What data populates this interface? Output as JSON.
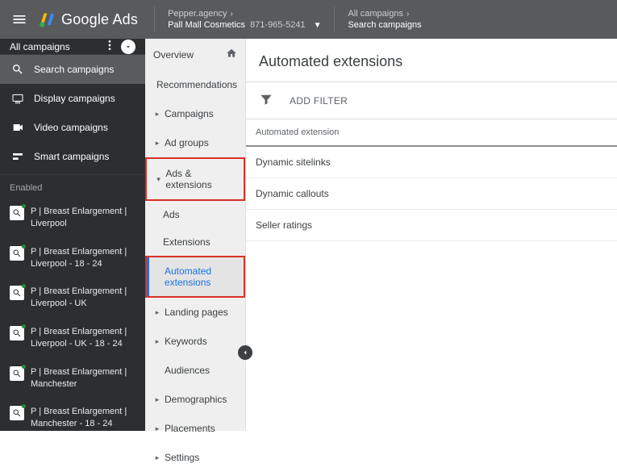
{
  "topbar": {
    "product_name": "Google Ads",
    "breadcrumb": [
      {
        "top": "Pepper.agency",
        "bottom": "Pall Mall Cosmetics",
        "account_id": "871-965-5241",
        "has_dropdown": true
      },
      {
        "top": "All campaigns",
        "bottom": "Search campaigns",
        "has_dropdown": false
      }
    ]
  },
  "leftnav": {
    "header_label": "All campaigns",
    "items": [
      {
        "label": "Search campaigns",
        "icon": "search-icon",
        "selected": true
      },
      {
        "label": "Display campaigns",
        "icon": "display-icon",
        "selected": false
      },
      {
        "label": "Video campaigns",
        "icon": "video-icon",
        "selected": false
      },
      {
        "label": "Smart campaigns",
        "icon": "smart-icon",
        "selected": false
      }
    ],
    "section_label": "Enabled",
    "campaigns": [
      {
        "label": "P | Breast Enlargement | Liverpool"
      },
      {
        "label": "P | Breast Enlargement | Liverpool - 18 - 24"
      },
      {
        "label": "P | Breast Enlargement | Liverpool - UK"
      },
      {
        "label": "P | Breast Enlargement | Liverpool - UK - 18 - 24"
      },
      {
        "label": "P | Breast Enlargement | Manchester"
      },
      {
        "label": "P | Breast Enlargement | Manchester - 18 - 24"
      }
    ]
  },
  "midnav": {
    "overview": "Overview",
    "recommendations": "Recommendations",
    "campaigns": "Campaigns",
    "adgroups": "Ad groups",
    "ads_extensions": "Ads & extensions",
    "ads": "Ads",
    "extensions": "Extensions",
    "automated_extensions": "Automated extensions",
    "landing_pages": "Landing pages",
    "keywords": "Keywords",
    "audiences": "Audiences",
    "demographics": "Demographics",
    "placements": "Placements",
    "settings": "Settings"
  },
  "main": {
    "title": "Automated extensions",
    "add_filter": "ADD FILTER",
    "table_header": "Automated extension",
    "rows": [
      {
        "name": "Dynamic sitelinks"
      },
      {
        "name": "Dynamic callouts"
      },
      {
        "name": "Seller ratings"
      }
    ]
  }
}
